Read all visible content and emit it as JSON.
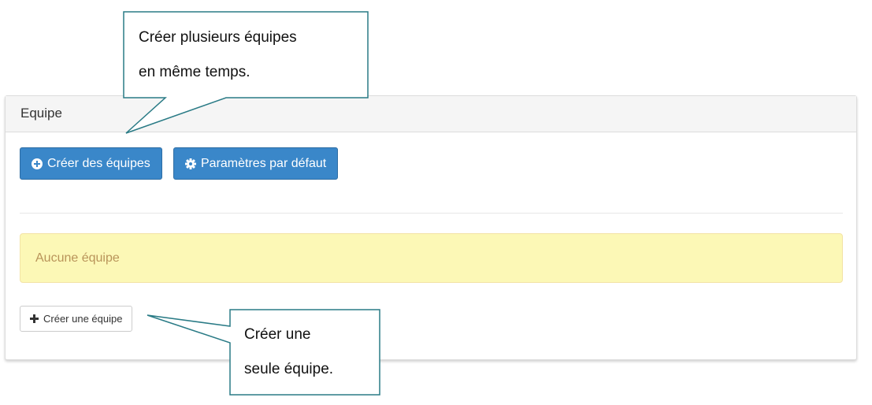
{
  "panel": {
    "title": "Equipe",
    "buttons": {
      "create_teams": "Créer des équipes",
      "default_settings": "Paramètres par défaut"
    },
    "empty_message": "Aucune équipe",
    "create_one_button": "Créer une équipe"
  },
  "callouts": {
    "top": {
      "line1": "Créer plusieurs équipes",
      "line2": "en même temps."
    },
    "bottom": {
      "line1": "Créer une",
      "line2": "seule équipe."
    }
  },
  "icons": {
    "create_teams": "plus-circle-icon",
    "default_settings": "gear-icon",
    "create_one": "plus-icon"
  },
  "colors": {
    "primary": "#3a87c9",
    "warning_bg": "#fcf8b6",
    "warning_text": "#b9945a",
    "callout_border": "#2a7b86"
  }
}
